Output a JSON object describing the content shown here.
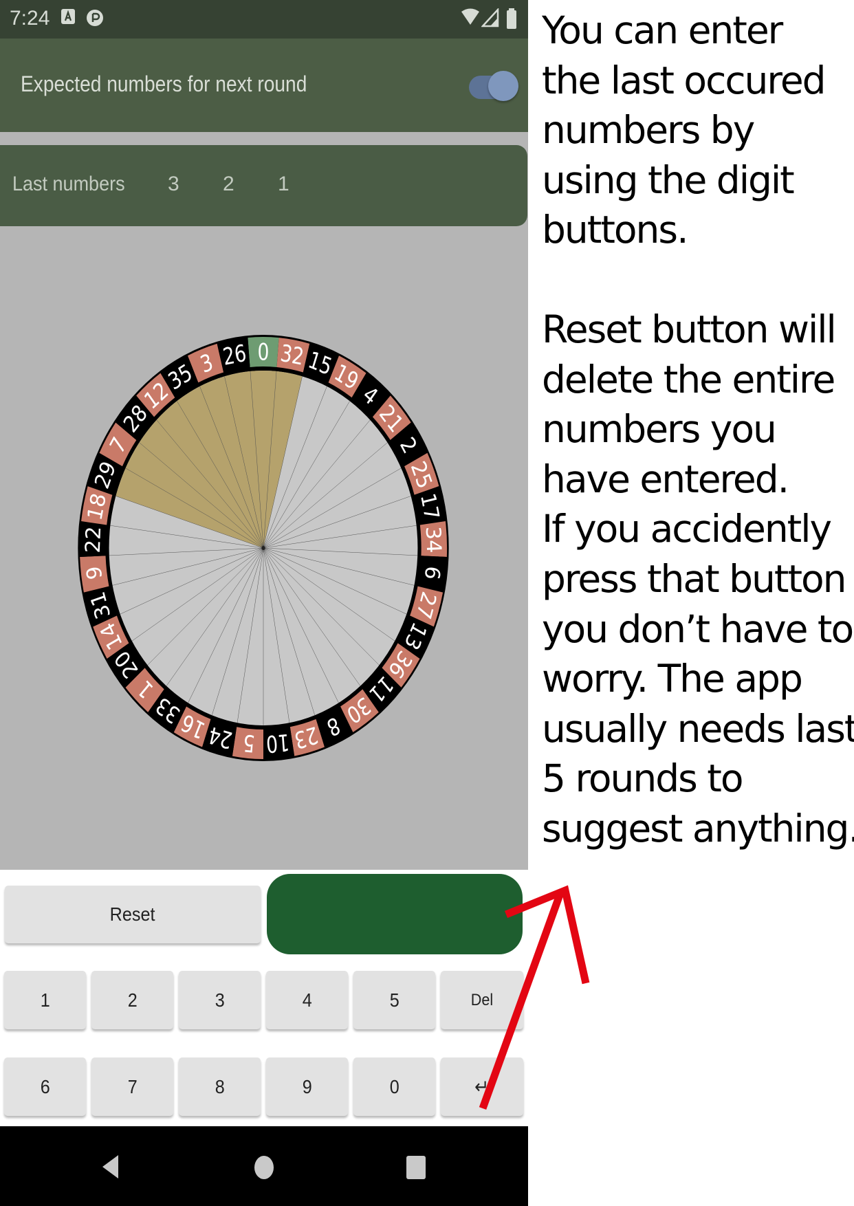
{
  "status_bar": {
    "time": "7:24"
  },
  "app_bar": {
    "title": "Expected numbers for next round",
    "toggle_on": true
  },
  "last_numbers": {
    "label": "Last numbers",
    "values": [
      "3",
      "2",
      "1"
    ]
  },
  "wheel": {
    "sequence": [
      "0",
      "32",
      "15",
      "19",
      "4",
      "21",
      "2",
      "25",
      "17",
      "34",
      "6",
      "27",
      "13",
      "36",
      "11",
      "30",
      "8",
      "23",
      "10",
      "5",
      "24",
      "16",
      "33",
      "1",
      "20",
      "14",
      "31",
      "9",
      "22",
      "18",
      "29",
      "7",
      "28",
      "12",
      "35",
      "3",
      "26"
    ],
    "red": [
      "32",
      "19",
      "21",
      "25",
      "34",
      "27",
      "36",
      "30",
      "23",
      "5",
      "16",
      "1",
      "14",
      "9",
      "18",
      "7",
      "12",
      "3"
    ],
    "green": [
      "0"
    ],
    "highlighted": [
      "29",
      "7",
      "28",
      "12",
      "35",
      "3",
      "26",
      "0",
      "32"
    ],
    "colors": {
      "red": "#c97a68",
      "black": "#000000",
      "green": "#6e9c72",
      "highlight": "#b5a26c",
      "pocket_fill": "#c8c8c8"
    }
  },
  "keypad": {
    "reset_label": "Reset",
    "row1": [
      "1",
      "2",
      "3",
      "4",
      "5",
      "Del"
    ],
    "row2": [
      "6",
      "7",
      "8",
      "9",
      "0",
      "↵"
    ]
  },
  "annotation": {
    "paragraph1": [
      "You can enter",
      "the last occured",
      "numbers by",
      "using the digit",
      "buttons."
    ],
    "paragraph2": [
      "Reset button will",
      "delete the entire",
      "numbers you",
      "have entered.",
      "If you accidently",
      "press that button",
      "you don’t have to",
      "worry. The app",
      "usually needs last",
      "5 rounds to",
      "suggest anything."
    ]
  },
  "accent_colors": {
    "app_bar": "#4c5d45",
    "status_bar": "#364233",
    "go_button": "#1e5e2f",
    "arrow": "#e30613"
  }
}
